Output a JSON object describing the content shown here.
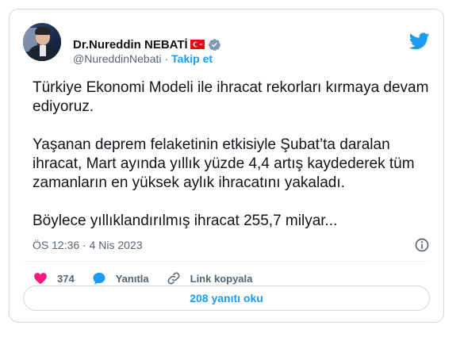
{
  "author": {
    "display_name": "Dr.Nureddin NEBATİ",
    "handle": "@NureddinNebati",
    "separator": "·",
    "follow_label": "Takip et",
    "flag_icon": "turkey-flag-icon",
    "verified_icon": "verified-badge-icon"
  },
  "tweet": {
    "paragraphs": [
      "Türkiye Ekonomi Modeli ile ihracat rekorları kırmaya devam ediyoruz.",
      "Yaşanan deprem felaketinin etkisiyle Şubat’ta daralan ihracat, Mart ayında yıllık yüzde 4,4 artış kaydederek tüm zamanların en yüksek aylık ihracatını yakaladı.",
      "Böylece yıllıklandırılmış ihracat 255,7 milyar..."
    ],
    "timestamp": "ÖS 12:36 · 4 Nis 2023"
  },
  "actions": {
    "like_count": "374",
    "reply_label": "Yanıtla",
    "copy_link_label": "Link kopyala"
  },
  "read_replies_label": "208 yanıtı oku",
  "colors": {
    "accent": "#1d9bf0",
    "like": "#f91880",
    "text": "#0f1419",
    "muted": "#536471",
    "border": "#cfd9de"
  }
}
